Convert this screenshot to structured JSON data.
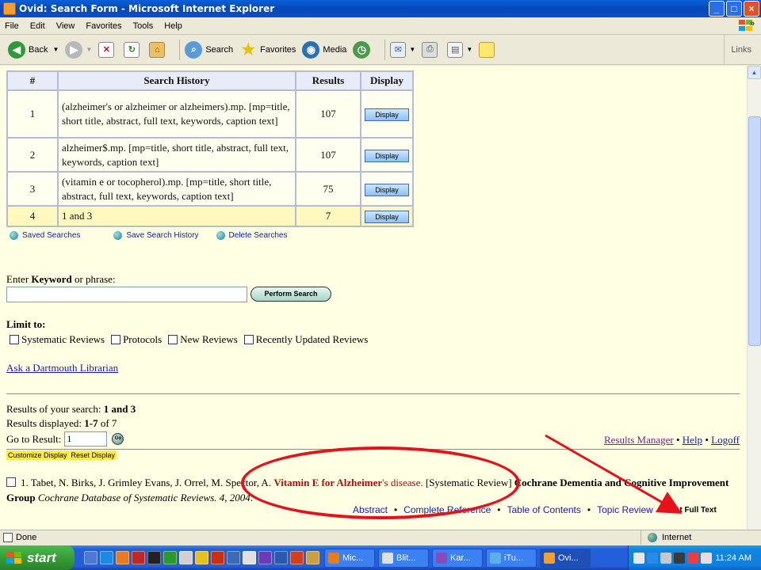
{
  "window": {
    "title": "Ovid: Search Form - Microsoft Internet Explorer"
  },
  "menu": [
    "File",
    "Edit",
    "View",
    "Favorites",
    "Tools",
    "Help"
  ],
  "toolbar": {
    "back": "Back",
    "search": "Search",
    "favorites": "Favorites",
    "media": "Media",
    "links": "Links",
    "chevron": "»"
  },
  "history": {
    "headers": [
      "#",
      "Search History",
      "Results",
      "Display"
    ],
    "rows": [
      {
        "num": "1",
        "query": "(alzheimer's or alzheimer or alzheimers).mp. [mp=title, short title, abstract, full text, keywords, caption text]",
        "results": "107",
        "display": "Display"
      },
      {
        "num": "2",
        "query": "alzheimer$.mp. [mp=title, short title, abstract, full text, keywords, caption text]",
        "results": "107",
        "display": "Display"
      },
      {
        "num": "3",
        "query": "(vitamin e or tocopherol).mp. [mp=title, short title, abstract, full text, keywords, caption text]",
        "results": "75",
        "display": "Display"
      },
      {
        "num": "4",
        "query": "1 and 3",
        "results": "7",
        "display": "Display"
      }
    ],
    "actions": [
      "Saved Searches",
      "Save Search History",
      "Delete Searches"
    ]
  },
  "keyword": {
    "label_prefix": "Enter ",
    "label_bold": "Keyword",
    "label_suffix": " or phrase:",
    "value": "",
    "button": "Perform Search"
  },
  "limit": {
    "label": "Limit to:",
    "options": [
      "Systematic Reviews",
      "Protocols",
      "New Reviews",
      "Recently Updated Reviews"
    ]
  },
  "librarian_link": "Ask a Dartmouth Librarian",
  "results": {
    "search_prefix": "Results of your search: ",
    "search_value": "1 and 3",
    "displayed_prefix": "Results displayed: ",
    "displayed_value": "1-7",
    "displayed_suffix": " of 7",
    "goto_label": "Go to Result:",
    "goto_value": "1",
    "go": "Go",
    "links": [
      "Results Manager",
      "Help",
      "Logoff"
    ],
    "customize": "Customize Display",
    "reset": "Reset Display"
  },
  "citation": {
    "num": "1.",
    "authors": "Tabet, N. Birks, J. Grimley Evans, J. Orrel, M. Spector, A.",
    "title_bold": "Vitamin E for Alzheimer",
    "title_rest": "'s disease.",
    "type": "[Systematic Review]",
    "group": "Cochrane Dementia and Cognitive Improvement Group",
    "journal": "Cochrane Database of Systematic Reviews. 4, 2004",
    "links": [
      "Abstract",
      "Complete Reference",
      "Table of Contents",
      "Topic Review"
    ],
    "full_text": "Get Full Text"
  },
  "status": {
    "text": "Done",
    "zone": "Internet"
  },
  "taskbar": {
    "start": "start",
    "tasks": [
      "Mic...",
      "Blit...",
      "Kar...",
      "iTu...",
      "Ovi..."
    ],
    "clock": "11:24 AM"
  },
  "colors": {
    "oval": "#e8101a",
    "arrow": "#e8101a",
    "link": "#1a1ab0"
  }
}
